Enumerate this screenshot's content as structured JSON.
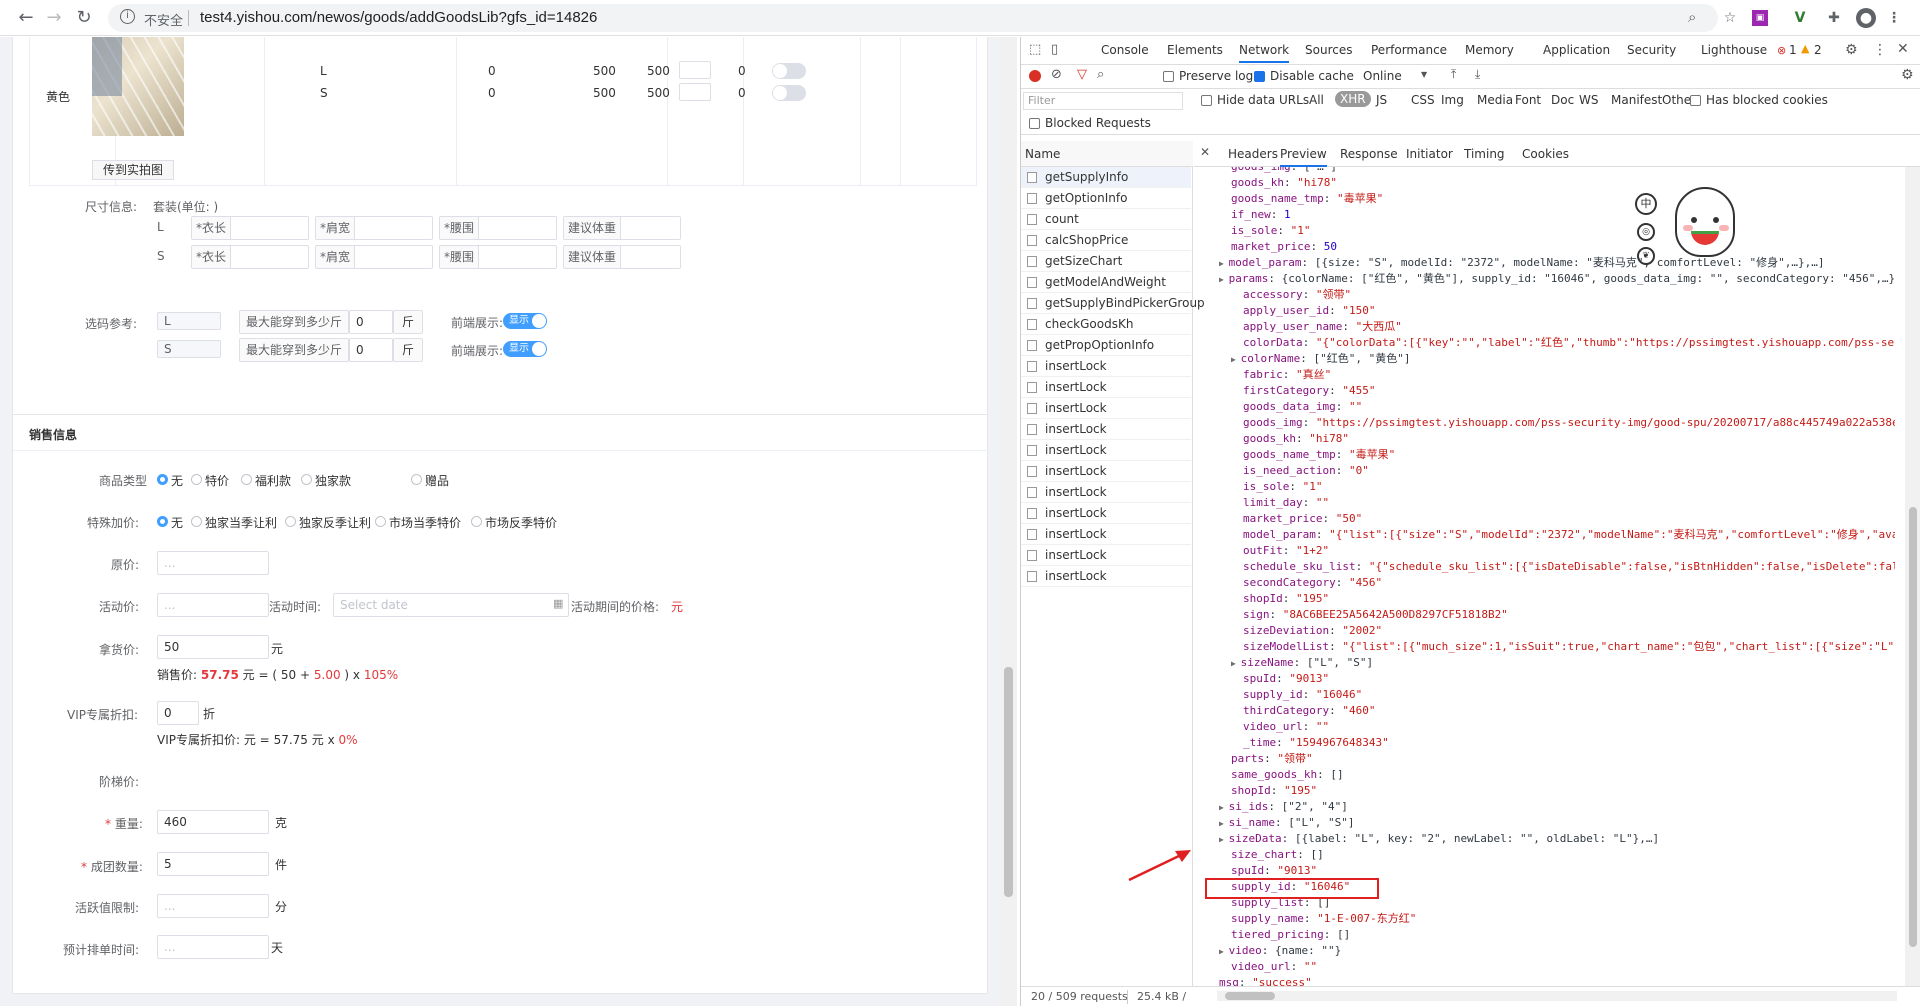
{
  "browser": {
    "security_label": "不安全",
    "url": "test4.yishou.com/newos/goods/addGoodsLib?gfs_id=14826"
  },
  "goods": {
    "color_label": "黄色",
    "upload_photo_btn": "传到实拍图",
    "sku_rows": [
      {
        "size": "L",
        "c1": "0",
        "c2": "500",
        "c3": "500",
        "c4": "0"
      },
      {
        "size": "S",
        "c1": "0",
        "c2": "500",
        "c3": "500",
        "c4": "0"
      }
    ],
    "size_info_label": "尺寸信息:",
    "suit_unit": "套装(单位: )",
    "size_rows": [
      {
        "size": "L",
        "f1": "*衣长",
        "f2": "*肩宽",
        "f3": "*腰围",
        "f4": "建议体重"
      },
      {
        "size": "S",
        "f1": "*衣长",
        "f2": "*肩宽",
        "f3": "*腰围",
        "f4": "建议体重"
      }
    ],
    "size_ref_label": "选码参考:",
    "ref_rows": [
      {
        "size": "L",
        "max_label": "最大能穿到多少斤",
        "value": "0",
        "unit": "斤",
        "front_label": "前端展示:",
        "switch": "显示"
      },
      {
        "size": "S",
        "max_label": "最大能穿到多少斤",
        "value": "0",
        "unit": "斤",
        "front_label": "前端展示:",
        "switch": "显示"
      }
    ]
  },
  "sales": {
    "title": "销售信息",
    "goods_type_label": "商品类型",
    "goods_type_options": [
      "无",
      "特价",
      "福利款",
      "独家款",
      "赠品"
    ],
    "special_label": "特殊加价:",
    "special_options": [
      "无",
      "独家当季让利",
      "独家反季让利",
      "市场当季特价",
      "市场反季特价"
    ],
    "orig_price_label": "原价:",
    "orig_price_ph": "...",
    "activity_price_label": "活动价:",
    "activity_price_ph": "...",
    "activity_time_label": "活动时间:",
    "date_ph": "Select date",
    "activity_period_label": "活动期间的价格:",
    "activity_period_value": "元",
    "take_price_label": "拿货价:",
    "take_price_value": "50",
    "take_price_unit": "元",
    "sale_price_label": "销售价:",
    "sale_price_value": "57.75",
    "sale_formula_a": "元 = (",
    "sale_formula_b": "50",
    "sale_formula_c": "+",
    "sale_formula_d": "5.00",
    "sale_formula_e": ") x",
    "sale_formula_f": "105%",
    "vip_label": "VIP专属折扣:",
    "vip_value": "0",
    "vip_unit": "折",
    "vip_price_label": "VIP专属折扣价:",
    "vip_price_a": "元 =",
    "vip_price_b": "57.75",
    "vip_price_c": "元 x",
    "vip_price_d": "0%",
    "tier_label": "阶梯价:",
    "weight_label": "重量:",
    "weight_value": "460",
    "weight_unit": "克",
    "group_label": "成团数量:",
    "group_value": "5",
    "group_unit": "件",
    "active_label": "活跃值限制:",
    "active_ph": "...",
    "active_unit": "分",
    "sched_label": "预计排单时间:",
    "sched_ph": "...",
    "sched_unit": "天"
  },
  "devtools": {
    "tabs": [
      "Console",
      "Elements",
      "Network",
      "Sources",
      "Performance",
      "Memory",
      "Application",
      "Security",
      "Lighthouse"
    ],
    "errors": "1",
    "warnings": "2",
    "preserve_log": "Preserve log",
    "disable_cache": "Disable cache",
    "online": "Online",
    "filter_ph": "Filter",
    "hide_data_urls": "Hide data URLs",
    "types": [
      "All",
      "XHR",
      "JS",
      "CSS",
      "Img",
      "Media",
      "Font",
      "Doc",
      "WS",
      "Manifest",
      "Other"
    ],
    "blocked_cookies": "Has blocked cookies",
    "blocked_requests": "Blocked Requests",
    "name_header": "Name",
    "detail_tabs": [
      "Headers",
      "Preview",
      "Response",
      "Initiator",
      "Timing",
      "Cookies"
    ],
    "requests": [
      "getSupplyInfo",
      "getOptionInfo",
      "count",
      "calcShopPrice",
      "getSizeChart",
      "getModelAndWeight",
      "getSupplyBindPickerGroup",
      "checkGoodsKh",
      "getPropOptionInfo",
      "insertLock",
      "insertLock",
      "insertLock",
      "insertLock",
      "insertLock",
      "insertLock",
      "insertLock",
      "insertLock",
      "insertLock",
      "insertLock",
      "insertLock"
    ],
    "status": "20 / 509 requests",
    "size": "25.4 kB /",
    "json_lines": [
      {
        "i": 2,
        "k": "goods_img",
        "v": "[\"…\"]",
        "c": "p",
        "x": true
      },
      {
        "i": 2,
        "k": "goods_kh",
        "v": "\"hi78\"",
        "c": "s"
      },
      {
        "i": 2,
        "k": "goods_name_tmp",
        "v": "\"毒苹果\"",
        "c": "s"
      },
      {
        "i": 2,
        "k": "if_new",
        "v": "1",
        "c": "n"
      },
      {
        "i": 2,
        "k": "is_sole",
        "v": "\"1\"",
        "c": "s"
      },
      {
        "i": 2,
        "k": "market_price",
        "v": "50",
        "c": "n"
      },
      {
        "i": 2,
        "k": "model_param",
        "v": "[{size: \"S\", modelId: \"2372\", modelName: \"麦科马克\", comfortLevel: \"修身\",…},…]",
        "c": "p",
        "t": 1
      },
      {
        "i": 2,
        "k": "params",
        "v": "{colorName: [\"红色\", \"黄色\"], supply_id: \"16046\", goods_data_img: \"\", secondCategory: \"456\",…}",
        "c": "p",
        "t": 2
      },
      {
        "i": 3,
        "k": "accessory",
        "v": "\"领带\"",
        "c": "s"
      },
      {
        "i": 3,
        "k": "apply_user_id",
        "v": "\"150\"",
        "c": "s"
      },
      {
        "i": 3,
        "k": "apply_user_name",
        "v": "\"大西瓜\"",
        "c": "s"
      },
      {
        "i": 3,
        "k": "colorData",
        "v": "\"{\"colorData\":[{\"key\":\"\",\"label\":\"红色\",\"thumb\":\"https://pssimgtest.yishouapp.com/pss-sec",
        "c": "s"
      },
      {
        "i": 3,
        "k": "colorName",
        "v": "[\"红色\", \"黄色\"]",
        "c": "p",
        "t": 1
      },
      {
        "i": 3,
        "k": "fabric",
        "v": "\"真丝\"",
        "c": "s"
      },
      {
        "i": 3,
        "k": "firstCategory",
        "v": "\"455\"",
        "c": "s"
      },
      {
        "i": 3,
        "k": "goods_data_img",
        "v": "\"\"",
        "c": "s"
      },
      {
        "i": 3,
        "k": "goods_img",
        "v": "\"https://pssimgtest.yishouapp.com/pss-security-img/good-spu/20200717/a88c445749a022a538e",
        "c": "s"
      },
      {
        "i": 3,
        "k": "goods_kh",
        "v": "\"hi78\"",
        "c": "s"
      },
      {
        "i": 3,
        "k": "goods_name_tmp",
        "v": "\"毒苹果\"",
        "c": "s"
      },
      {
        "i": 3,
        "k": "is_need_action",
        "v": "\"0\"",
        "c": "s"
      },
      {
        "i": 3,
        "k": "is_sole",
        "v": "\"1\"",
        "c": "s"
      },
      {
        "i": 3,
        "k": "limit_day",
        "v": "\"\"",
        "c": "s"
      },
      {
        "i": 3,
        "k": "market_price",
        "v": "\"50\"",
        "c": "s"
      },
      {
        "i": 3,
        "k": "model_param",
        "v": "\"{\"list\":[{\"size\":\"S\",\"modelId\":\"2372\",\"modelName\":\"麦科马克\",\"comfortLevel\":\"修身\",\"ava",
        "c": "s"
      },
      {
        "i": 3,
        "k": "outFit",
        "v": "\"1+2\"",
        "c": "s"
      },
      {
        "i": 3,
        "k": "schedule_sku_list",
        "v": "\"{\"schedule_sku_list\":[{\"isDateDisable\":false,\"isBtnHidden\":false,\"isDelete\":fals",
        "c": "s"
      },
      {
        "i": 3,
        "k": "secondCategory",
        "v": "\"456\"",
        "c": "s"
      },
      {
        "i": 3,
        "k": "shopId",
        "v": "\"195\"",
        "c": "s"
      },
      {
        "i": 3,
        "k": "sign",
        "v": "\"8AC6BEE25A5642A500D8297CF51818B2\"",
        "c": "s"
      },
      {
        "i": 3,
        "k": "sizeDeviation",
        "v": "\"2002\"",
        "c": "s"
      },
      {
        "i": 3,
        "k": "sizeModelList",
        "v": "\"{\"list\":[{\"much_size\":1,\"isSuit\":true,\"chart_name\":\"包包\",\"chart_list\":[{\"size\":\"L\",",
        "c": "s"
      },
      {
        "i": 3,
        "k": "sizeName",
        "v": "[\"L\", \"S\"]",
        "c": "p",
        "t": 1
      },
      {
        "i": 3,
        "k": "spuId",
        "v": "\"9013\"",
        "c": "s"
      },
      {
        "i": 3,
        "k": "supply_id",
        "v": "\"16046\"",
        "c": "s"
      },
      {
        "i": 3,
        "k": "thirdCategory",
        "v": "\"460\"",
        "c": "s"
      },
      {
        "i": 3,
        "k": "video_url",
        "v": "\"\"",
        "c": "s"
      },
      {
        "i": 3,
        "k": "_time",
        "v": "\"1594967648343\"",
        "c": "s"
      },
      {
        "i": 2,
        "k": "parts",
        "v": "\"领带\"",
        "c": "s"
      },
      {
        "i": 2,
        "k": "same_goods_kh",
        "v": "[]",
        "c": "p"
      },
      {
        "i": 2,
        "k": "shopId",
        "v": "\"195\"",
        "c": "s"
      },
      {
        "i": 2,
        "k": "si_ids",
        "v": "[\"2\", \"4\"]",
        "c": "p",
        "t": 1
      },
      {
        "i": 2,
        "k": "si_name",
        "v": "[\"L\", \"S\"]",
        "c": "p",
        "t": 1
      },
      {
        "i": 2,
        "k": "sizeData",
        "v": "[{label: \"L\", key: \"2\", newLabel: \"\", oldLabel: \"L\"},…]",
        "c": "p",
        "t": 1
      },
      {
        "i": 2,
        "k": "size_chart",
        "v": "[]",
        "c": "p",
        "hl": true
      },
      {
        "i": 2,
        "k": "spuId",
        "v": "\"9013\"",
        "c": "s"
      },
      {
        "i": 2,
        "k": "supply_id",
        "v": "\"16046\"",
        "c": "s"
      },
      {
        "i": 2,
        "k": "supply_list",
        "v": "[]",
        "c": "p"
      },
      {
        "i": 2,
        "k": "supply_name",
        "v": "\"1-E-007-东方红\"",
        "c": "s"
      },
      {
        "i": 2,
        "k": "tiered_pricing",
        "v": "[]",
        "c": "p"
      },
      {
        "i": 2,
        "k": "video",
        "v": "{name: \"\"}",
        "c": "p",
        "t": 1
      },
      {
        "i": 2,
        "k": "video_url",
        "v": "\"\"",
        "c": "s"
      },
      {
        "i": 1,
        "k": "msg",
        "v": "\"success\"",
        "c": "s"
      }
    ],
    "ime_label": "中"
  },
  "colors": {
    "accent": "#409eff",
    "highlight": "#e02020",
    "red": "#e4393c"
  }
}
